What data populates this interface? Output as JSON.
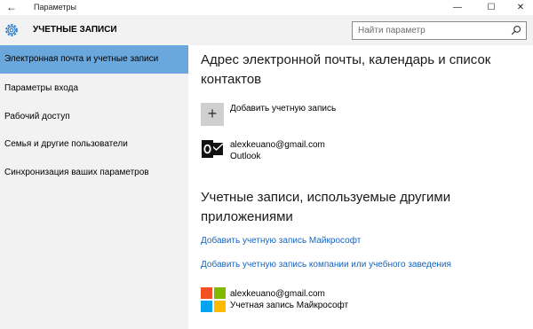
{
  "window": {
    "title": "Параметры",
    "back_glyph": "←",
    "minimize_glyph": "—",
    "maximize_glyph": "☐",
    "close_glyph": "✕"
  },
  "header": {
    "title": "УЧЕТНЫЕ ЗАПИСИ",
    "search_placeholder": "Найти параметр"
  },
  "sidebar": {
    "items": [
      {
        "label": "Электронная почта и учетные записи",
        "active": true
      },
      {
        "label": "Параметры входа",
        "active": false
      },
      {
        "label": "Рабочий доступ",
        "active": false
      },
      {
        "label": "Семья и другие пользователи",
        "active": false
      },
      {
        "label": "Синхронизация ваших параметров",
        "active": false
      }
    ]
  },
  "main": {
    "section1_title": "Адрес электронной почты, календарь и список контактов",
    "add_account_label": "Добавить учетную запись",
    "add_glyph": "+",
    "account1": {
      "email": "alexkeuano@gmail.com",
      "type": "Outlook",
      "icon": "outlook-icon"
    },
    "section2_title": "Учетные записи, используемые другими приложениями",
    "link_add_microsoft": "Добавить учетную запись Майкрософт",
    "link_add_work": "Добавить учетную запись компании или учебного заведения",
    "account2": {
      "email": "alexkeuano@gmail.com",
      "type": "Учетная запись Майкрософт",
      "icon": "microsoft-logo-icon"
    }
  },
  "colors": {
    "accent": "#6aa7dc",
    "link": "#1565c0",
    "sidebar_bg": "#f2f2f2",
    "ms_red": "#f25022",
    "ms_green": "#7fba00",
    "ms_blue": "#00a4ef",
    "ms_yellow": "#ffb900"
  }
}
